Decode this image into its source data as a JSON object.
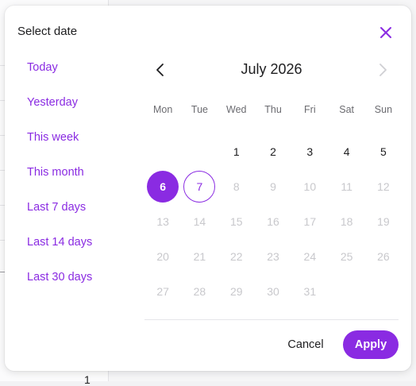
{
  "dialog": {
    "title": "Select date",
    "close_icon": "close-icon",
    "accent_color": "#8a2be2"
  },
  "presets": [
    {
      "label": "Today"
    },
    {
      "label": "Yesterday"
    },
    {
      "label": "This week"
    },
    {
      "label": "This month"
    },
    {
      "label": "Last 7 days"
    },
    {
      "label": "Last 14 days"
    },
    {
      "label": "Last 30 days"
    }
  ],
  "calendar": {
    "month_label": "July 2026",
    "prev_icon": "chevron-left-icon",
    "next_icon": "chevron-right-icon",
    "next_disabled": true,
    "weekdays": [
      "Mon",
      "Tue",
      "Wed",
      "Thu",
      "Fri",
      "Sat",
      "Sun"
    ],
    "leading_blanks": 2,
    "days": [
      {
        "n": "1",
        "state": "enabled"
      },
      {
        "n": "2",
        "state": "enabled"
      },
      {
        "n": "3",
        "state": "enabled"
      },
      {
        "n": "4",
        "state": "enabled"
      },
      {
        "n": "5",
        "state": "enabled"
      },
      {
        "n": "6",
        "state": "selected"
      },
      {
        "n": "7",
        "state": "today"
      },
      {
        "n": "8",
        "state": "disabled"
      },
      {
        "n": "9",
        "state": "disabled"
      },
      {
        "n": "10",
        "state": "disabled"
      },
      {
        "n": "11",
        "state": "disabled"
      },
      {
        "n": "12",
        "state": "disabled"
      },
      {
        "n": "13",
        "state": "disabled"
      },
      {
        "n": "14",
        "state": "disabled"
      },
      {
        "n": "15",
        "state": "disabled"
      },
      {
        "n": "16",
        "state": "disabled"
      },
      {
        "n": "17",
        "state": "disabled"
      },
      {
        "n": "18",
        "state": "disabled"
      },
      {
        "n": "19",
        "state": "disabled"
      },
      {
        "n": "20",
        "state": "disabled"
      },
      {
        "n": "21",
        "state": "disabled"
      },
      {
        "n": "22",
        "state": "disabled"
      },
      {
        "n": "23",
        "state": "disabled"
      },
      {
        "n": "24",
        "state": "disabled"
      },
      {
        "n": "25",
        "state": "disabled"
      },
      {
        "n": "26",
        "state": "disabled"
      },
      {
        "n": "27",
        "state": "disabled"
      },
      {
        "n": "28",
        "state": "disabled"
      },
      {
        "n": "29",
        "state": "disabled"
      },
      {
        "n": "30",
        "state": "disabled"
      },
      {
        "n": "31",
        "state": "disabled"
      }
    ]
  },
  "footer": {
    "cancel_label": "Cancel",
    "apply_label": "Apply"
  },
  "background": {
    "partial_digit": "1"
  }
}
